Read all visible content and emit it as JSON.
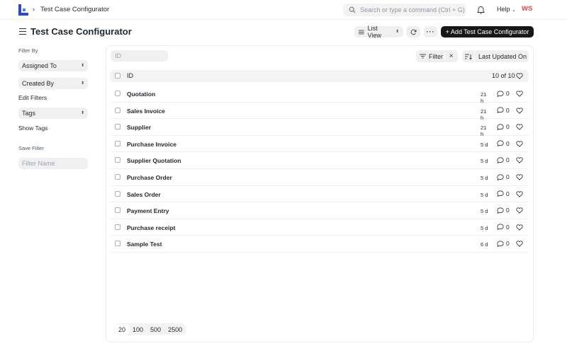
{
  "navbar": {
    "breadcrumb": "Test Case Configurator",
    "search_placeholder": "Search or type a command (Ctrl + G)",
    "help_label": "Help",
    "avatar_initials": "WS"
  },
  "header": {
    "title": "Test Case Configurator",
    "view_label": "List View",
    "more_label": "···",
    "add_label": "+ Add Test Case Configurator"
  },
  "sidebar": {
    "filter_by_label": "Filter By",
    "assigned_to": "Assigned To",
    "created_by": "Created By",
    "edit_filters": "Edit Filters",
    "tags": "Tags",
    "show_tags": "Show Tags",
    "save_filter_label": "Save Filter",
    "filter_name_placeholder": "Filter Name"
  },
  "list": {
    "id_placeholder": "ID",
    "filter_label": "Filter",
    "filter_clear": "×",
    "sort_label": "Last Updated On",
    "column_id": "ID",
    "count": "10 of 10",
    "rows": [
      {
        "title": "Quotation",
        "time": "21 h",
        "comments": "0"
      },
      {
        "title": "Sales Invoice",
        "time": "21 h",
        "comments": "0"
      },
      {
        "title": "Supplier",
        "time": "21 h",
        "comments": "0"
      },
      {
        "title": "Purchase Invoice",
        "time": "5 d",
        "comments": "0"
      },
      {
        "title": "Supplier Quotation",
        "time": "5 d",
        "comments": "0"
      },
      {
        "title": "Purchase Order",
        "time": "5 d",
        "comments": "0"
      },
      {
        "title": "Sales Order",
        "time": "5 d",
        "comments": "0"
      },
      {
        "title": "Payment Entry",
        "time": "5 d",
        "comments": "0"
      },
      {
        "title": "Purchase receipt",
        "time": "5 d",
        "comments": "0"
      },
      {
        "title": "Sample Test",
        "time": "6 d",
        "comments": "0"
      }
    ]
  },
  "pager": {
    "sizes": [
      "20",
      "100",
      "500",
      "2500"
    ]
  },
  "colors": {
    "primary_button": "#171717",
    "avatar": "#e24c4c"
  }
}
